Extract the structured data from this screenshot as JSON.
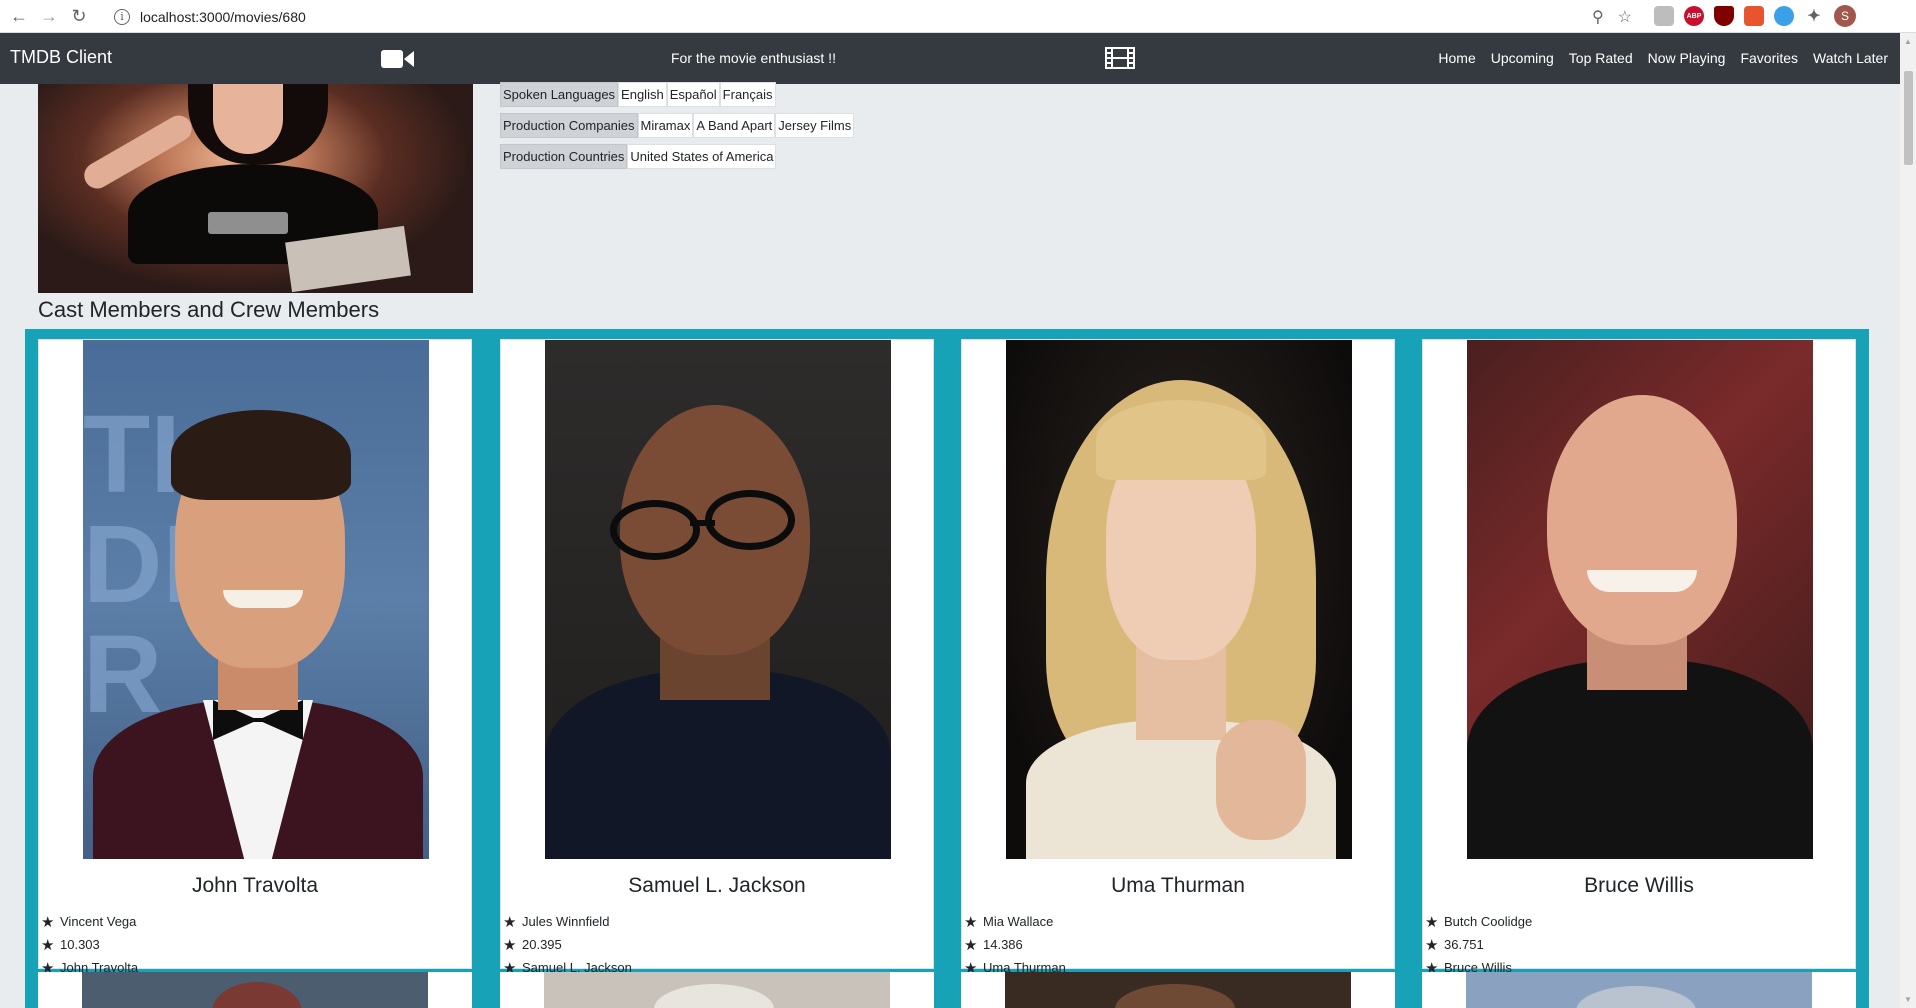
{
  "browser": {
    "url": "localhost:3000/movies/680",
    "avatar_letter": "S",
    "ext_abp": "ABP"
  },
  "navbar": {
    "brand": "TMDB Client",
    "tagline": "For the movie enthusiast !!",
    "links": [
      "Home",
      "Upcoming",
      "Top Rated",
      "Now Playing",
      "Favorites",
      "Watch Later"
    ]
  },
  "details": {
    "spoken_languages_label": "Spoken Languages",
    "spoken_languages": [
      "English",
      "Español",
      "Français"
    ],
    "production_companies_label": "Production Companies",
    "production_companies": [
      "Miramax",
      "A Band Apart",
      "Jersey Films"
    ],
    "production_countries_label": "Production Countries",
    "production_countries": [
      "United States of America"
    ]
  },
  "cast_section_title": "Cast Members and Crew Members",
  "cast": [
    {
      "name": "John Travolta",
      "character": "Vincent Vega",
      "popularity": "10.303",
      "original_name": "John Travolta"
    },
    {
      "name": "Samuel L. Jackson",
      "character": "Jules Winnfield",
      "popularity": "20.395",
      "original_name": "Samuel L. Jackson"
    },
    {
      "name": "Uma Thurman",
      "character": "Mia Wallace",
      "popularity": "14.386",
      "original_name": "Uma Thurman"
    },
    {
      "name": "Bruce Willis",
      "character": "Butch Coolidge",
      "popularity": "36.751",
      "original_name": "Bruce Willis"
    }
  ],
  "icons": {
    "back": "arrow-left-icon",
    "forward": "arrow-right-icon",
    "reload": "reload-icon",
    "info": "info-icon",
    "zoom": "zoom-icon",
    "star": "star-icon",
    "camera": "video-camera-icon",
    "film": "film-icon"
  },
  "colors": {
    "navbar": "#343a40",
    "cast_panel": "#17a2b8",
    "page_bg": "#e9ecef"
  }
}
